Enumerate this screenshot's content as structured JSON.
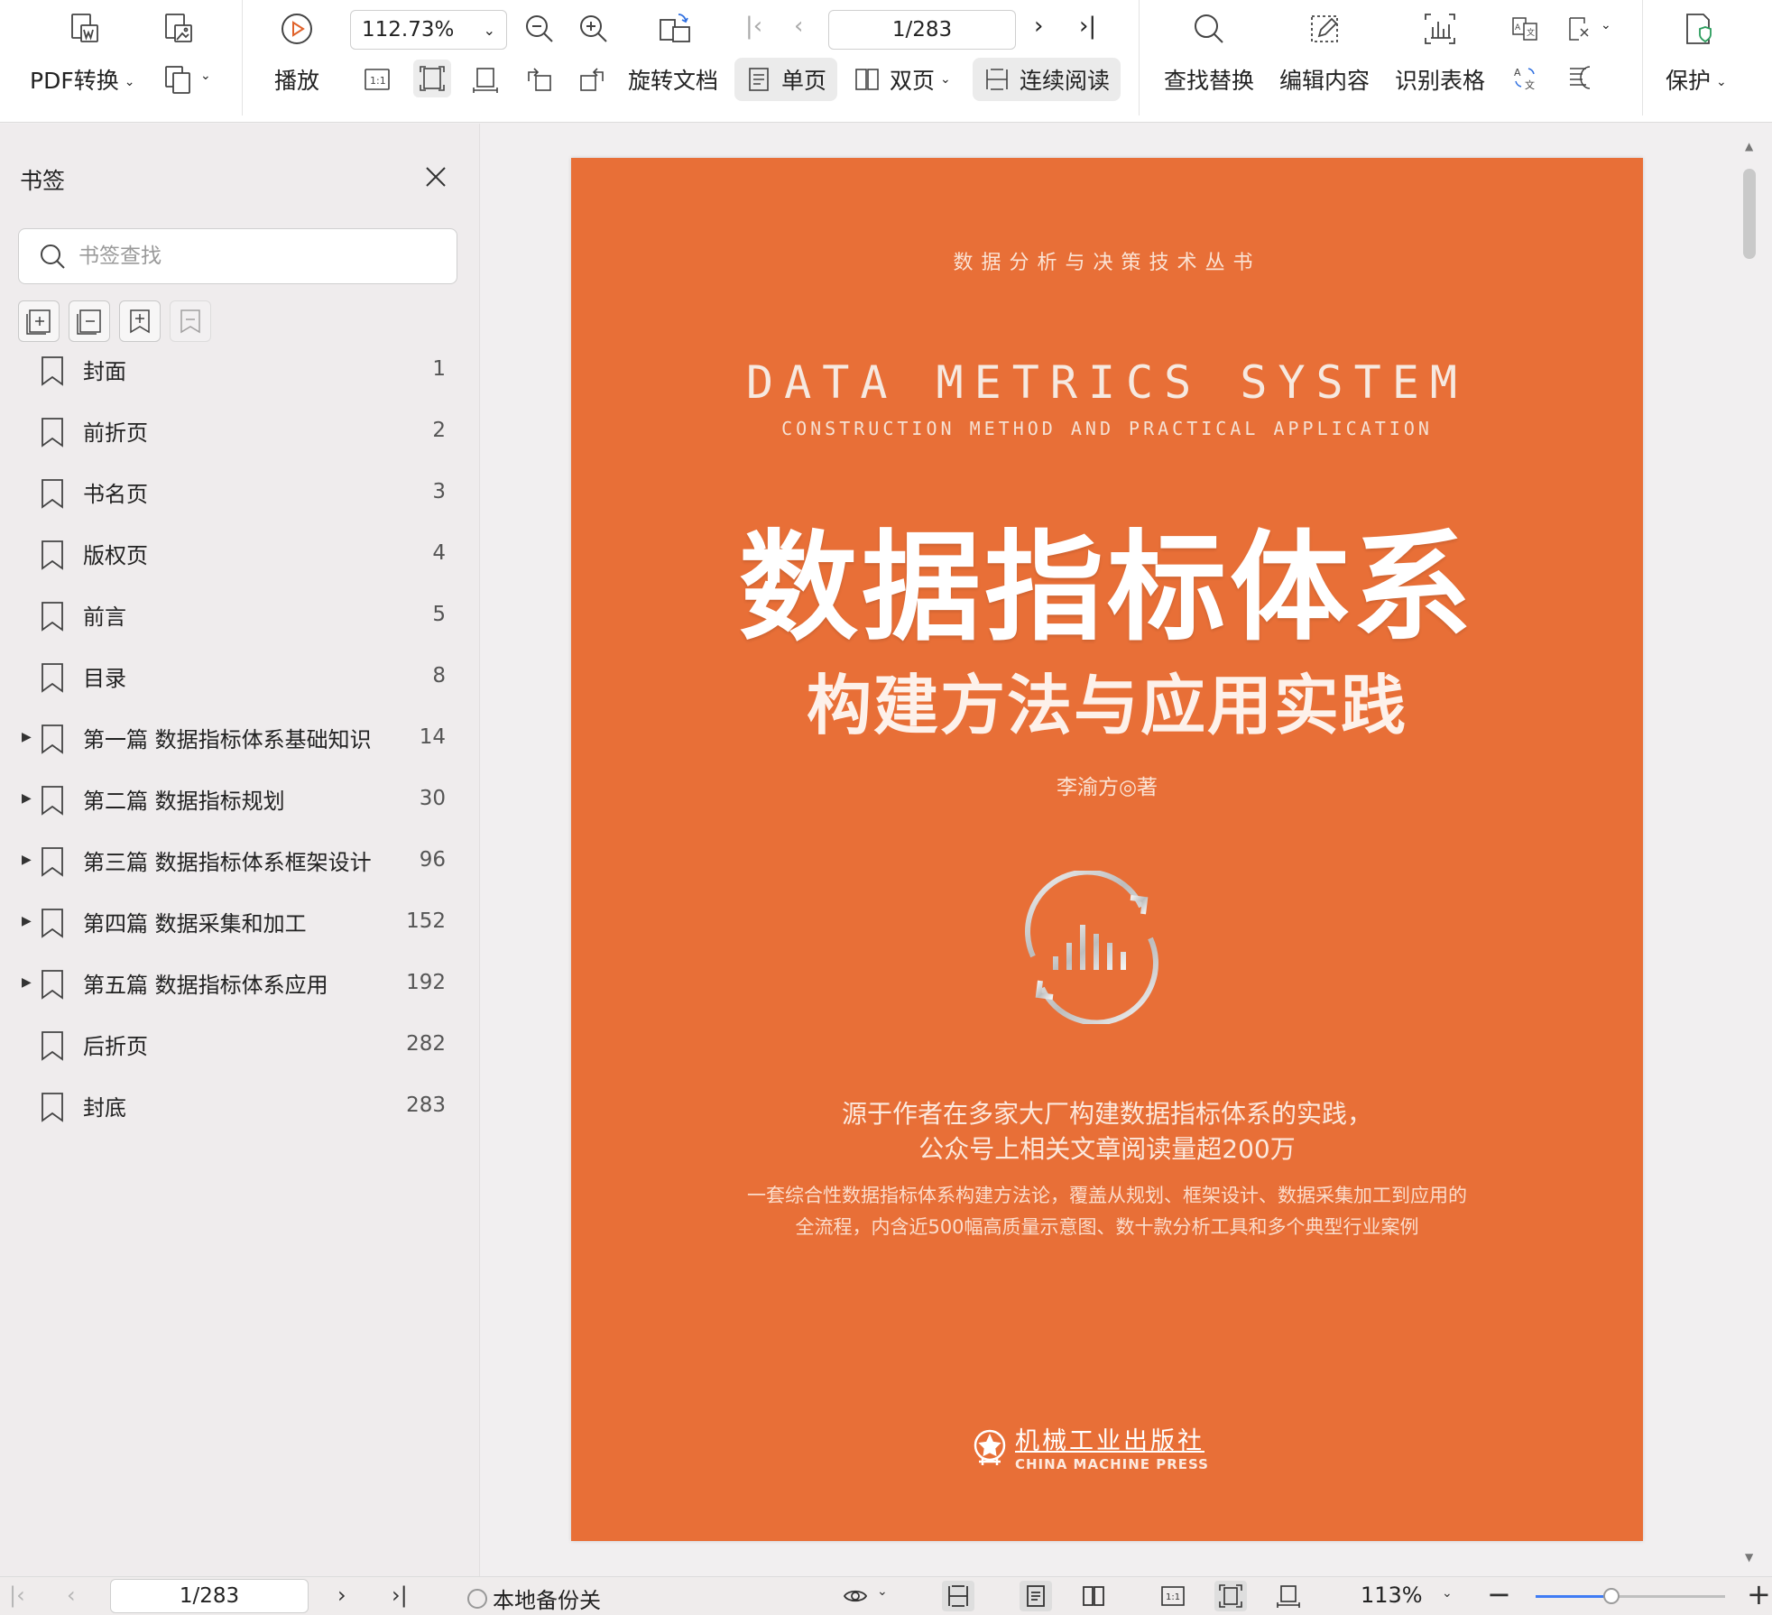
{
  "toolbar": {
    "pdf_convert_label": "PDF转换",
    "play_label": "播放",
    "zoom_value": "112.73%",
    "page_indicator": "1/283",
    "rotate_label": "旋转文档",
    "single_page_label": "单页",
    "double_page_label": "双页",
    "continuous_label": "连续阅读",
    "find_replace_label": "查找替换",
    "edit_content_label": "编辑内容",
    "recognize_table_label": "识别表格",
    "protect_label": "保护"
  },
  "sidebar": {
    "title": "书签",
    "search_placeholder": "书签查找",
    "bookmarks": [
      {
        "label": "封面",
        "page": "1",
        "expandable": false
      },
      {
        "label": "前折页",
        "page": "2",
        "expandable": false
      },
      {
        "label": "书名页",
        "page": "3",
        "expandable": false
      },
      {
        "label": "版权页",
        "page": "4",
        "expandable": false
      },
      {
        "label": "前言",
        "page": "5",
        "expandable": false
      },
      {
        "label": "目录",
        "page": "8",
        "expandable": false
      },
      {
        "label": "第一篇 数据指标体系基础知识",
        "page": "14",
        "expandable": true
      },
      {
        "label": "第二篇 数据指标规划",
        "page": "30",
        "expandable": true
      },
      {
        "label": "第三篇 数据指标体系框架设计",
        "page": "96",
        "expandable": true
      },
      {
        "label": "第四篇 数据采集和加工",
        "page": "152",
        "expandable": true
      },
      {
        "label": "第五篇 数据指标体系应用",
        "page": "192",
        "expandable": true
      },
      {
        "label": "后折页",
        "page": "282",
        "expandable": false
      },
      {
        "label": "封底",
        "page": "283",
        "expandable": false
      }
    ]
  },
  "document": {
    "series": "数据分析与决策技术丛书",
    "en_title": "DATA METRICS SYSTEM",
    "en_subtitle": "CONSTRUCTION METHOD AND PRACTICAL APPLICATION",
    "main_title": "数据指标体系",
    "sub_title": "构建方法与应用实践",
    "author": "李渝方◎著",
    "tagline_1": "源于作者在多家大厂构建数据指标体系的实践，",
    "tagline_2": "公众号上相关文章阅读量超200万",
    "desc_1": "一套综合性数据指标体系构建方法论，覆盖从规划、框架设计、数据采集加工到应用的",
    "desc_2": "全流程，内含近500幅高质量示意图、数十款分析工具和多个典型行业案例",
    "publisher_cn": "机械工业出版社",
    "publisher_en": "CHINA MACHINE PRESS",
    "cover_color": "#e86f37"
  },
  "statusbar": {
    "page_indicator": "1/283",
    "backup_label": "本地备份关",
    "zoom_value": "113%",
    "zoom_slider_fraction": 0.4
  }
}
